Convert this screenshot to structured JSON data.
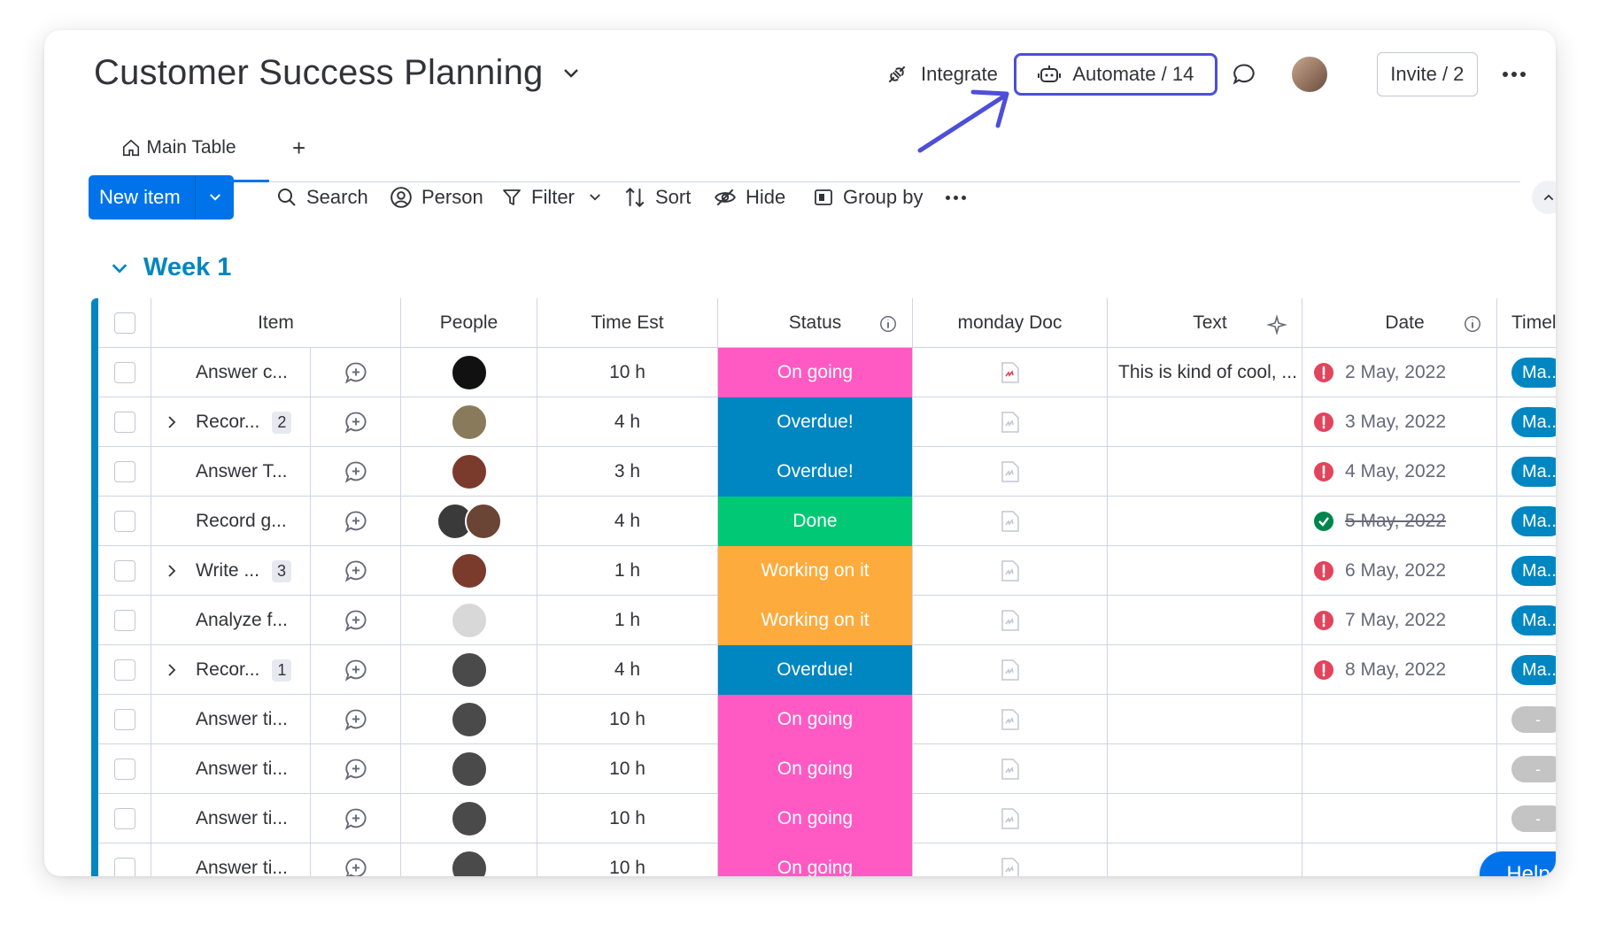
{
  "board": {
    "title": "Customer Success Planning"
  },
  "header": {
    "integrate_label": "Integrate",
    "automate_label": "Automate / 14",
    "invite_label": "Invite / 2"
  },
  "tabs": {
    "main_label": "Main Table",
    "add_label": "+"
  },
  "toolbar": {
    "new_item": "New item",
    "search": "Search",
    "person": "Person",
    "filter": "Filter",
    "sort": "Sort",
    "hide": "Hide",
    "group_by": "Group by"
  },
  "group": {
    "title": "Week 1",
    "color": "#0086c0"
  },
  "columns": {
    "item": "Item",
    "people": "People",
    "time": "Time Est",
    "status": "Status",
    "doc": "monday Doc",
    "text": "Text",
    "date": "Date",
    "timeline": "Timeli"
  },
  "status_colors": {
    "On going": "#ff5ac4",
    "Overdue!": "#0086c0",
    "Done": "#00c875",
    "Working on it": "#fdab3d"
  },
  "rows": [
    {
      "item": "Answer c...",
      "subitems": "",
      "time": "10 h",
      "status": "On going",
      "text": "This is kind of cool, ...",
      "date": "2 May, 2022",
      "date_state": "overdue",
      "timeline": "Ma..",
      "avatars": [
        "#111111"
      ],
      "doc_color": true
    },
    {
      "item": "Recor...",
      "subitems": "2",
      "time": "4 h",
      "status": "Overdue!",
      "text": "",
      "date": "3 May, 2022",
      "date_state": "overdue",
      "timeline": "Ma..",
      "avatars": [
        "#8a7a5c"
      ]
    },
    {
      "item": "Answer T...",
      "subitems": "",
      "time": "3 h",
      "status": "Overdue!",
      "text": "",
      "date": "4 May, 2022",
      "date_state": "overdue",
      "timeline": "Ma..",
      "avatars": [
        "#7a3a2c"
      ]
    },
    {
      "item": "Record g...",
      "subitems": "",
      "time": "4 h",
      "status": "Done",
      "text": "",
      "date": "5 May, 2022",
      "date_state": "done",
      "timeline": "Ma..",
      "avatars": [
        "#3a3a3a",
        "#6a4434"
      ]
    },
    {
      "item": "Write ...",
      "subitems": "3",
      "time": "1 h",
      "status": "Working on it",
      "text": "",
      "date": "6 May, 2022",
      "date_state": "overdue",
      "timeline": "Ma..",
      "avatars": [
        "#7a3a2c"
      ]
    },
    {
      "item": "Analyze f...",
      "subitems": "",
      "time": "1 h",
      "status": "Working on it",
      "text": "",
      "date": "7 May, 2022",
      "date_state": "overdue",
      "timeline": "Ma..",
      "avatars": [
        "#d8d8d8"
      ]
    },
    {
      "item": "Recor...",
      "subitems": "1",
      "time": "4 h",
      "status": "Overdue!",
      "text": "",
      "date": "8 May, 2022",
      "date_state": "overdue",
      "timeline": "Ma..",
      "avatars": [
        "#4a4a4a"
      ]
    },
    {
      "item": "Answer ti...",
      "subitems": "",
      "time": "10 h",
      "status": "On going",
      "text": "",
      "date": "",
      "date_state": "",
      "timeline": "-",
      "avatars": [
        "#4a4a4a"
      ]
    },
    {
      "item": "Answer ti...",
      "subitems": "",
      "time": "10 h",
      "status": "On going",
      "text": "",
      "date": "",
      "date_state": "",
      "timeline": "-",
      "avatars": [
        "#4a4a4a"
      ]
    },
    {
      "item": "Answer ti...",
      "subitems": "",
      "time": "10 h",
      "status": "On going",
      "text": "",
      "date": "",
      "date_state": "",
      "timeline": "-",
      "avatars": [
        "#4a4a4a"
      ]
    },
    {
      "item": "Answer ti...",
      "subitems": "",
      "time": "10 h",
      "status": "On going",
      "text": "",
      "date": "",
      "date_state": "",
      "timeline": "",
      "avatars": [
        "#4a4a4a"
      ]
    }
  ],
  "help": {
    "label": "Help"
  }
}
